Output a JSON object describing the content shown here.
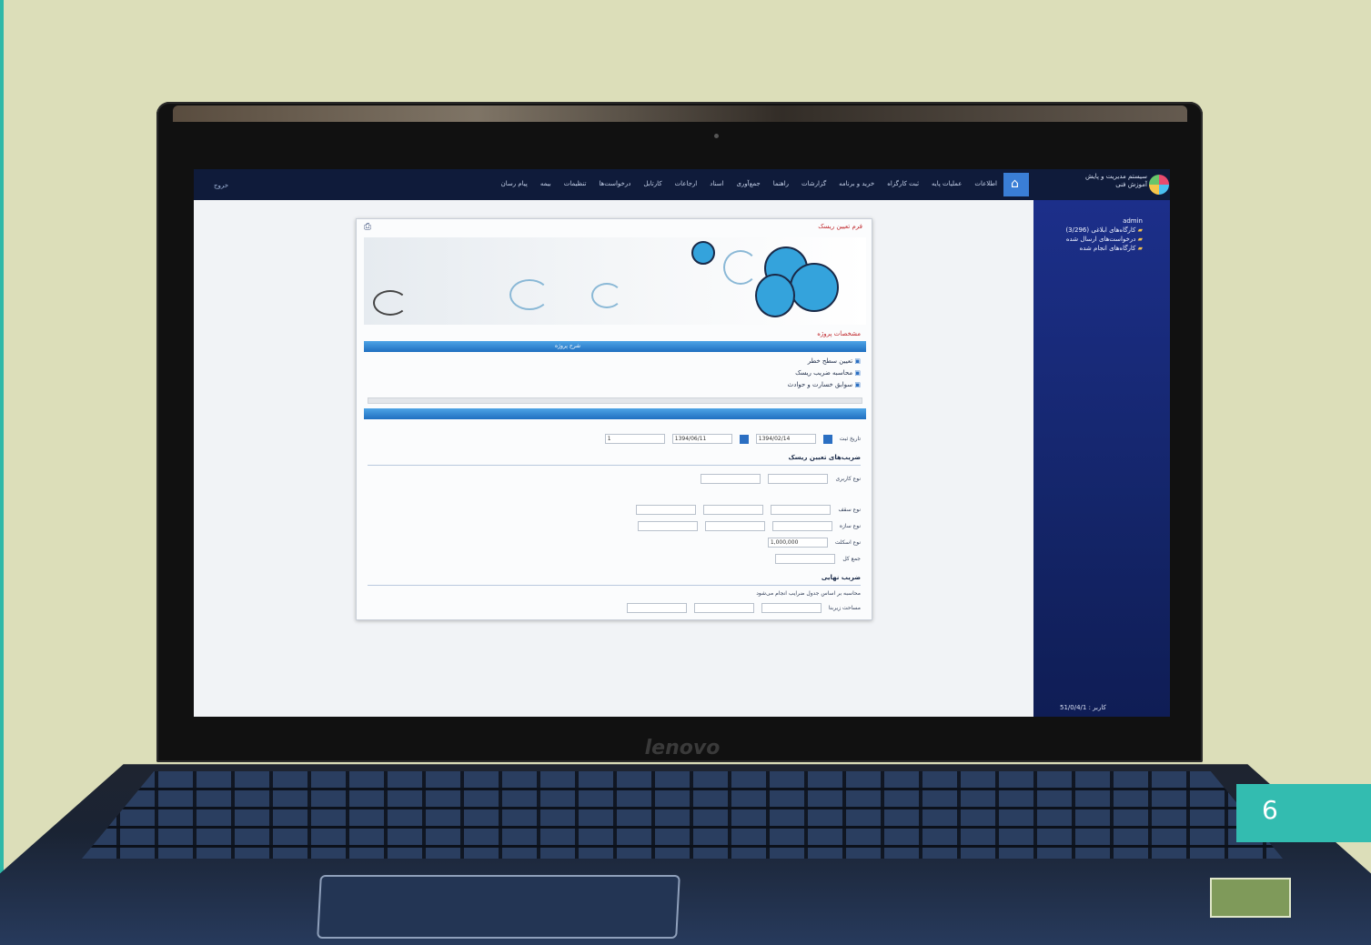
{
  "page_number": "6",
  "laptop": {
    "brand": "lenovo"
  },
  "app": {
    "logout_label": "خروج",
    "menu_items": [
      "اطلاعات",
      "عملیات پایه",
      "ثبت کارگزاه",
      "خرید و برنامه",
      "گزارشات",
      "راهنما",
      "جمع‌آوری",
      "اسناد",
      "ارجاعات",
      "کارتابل",
      "درخواست‌ها",
      "تنظیمات",
      "بیمه",
      "پیام رسان"
    ],
    "logo_text": [
      "سیستم مدیریت و پایش",
      "آموزش فنی"
    ],
    "sidebar_tree": [
      "admin",
      "کارگاه‌های ابلاغی (3/296)",
      "درخواست‌های ارسال شده",
      "کارگاه‌های انجام شده"
    ],
    "sidebar_footer": "کاربر : 51/0/4/1"
  },
  "window": {
    "title": "فرم تعیین ریسک",
    "section": "مشخصات پروژه",
    "table_header": "شرح پروژه",
    "list_items": [
      "تعیین سطح خطر",
      "محاسبه ضریب ریسک",
      "سوابق خسارت و حوادث"
    ],
    "form": {
      "date_label": "تاریخ ثبت",
      "date_value": "1394/02/14",
      "date2_value": "1394/06/11",
      "count_value": "1",
      "section_header": "ضریب‌های تعیین ریسک",
      "rows": [
        "نوع کاربری",
        "نوع سقف",
        "نوع سازه",
        "نوع اسکلت",
        "مساحت زیربنا"
      ],
      "total_value": "1,000,000",
      "total_label": "جمع کل",
      "footer_header": "ضریب نهایی",
      "footer_note": "محاسبه بر اساس جدول ضرایب انجام می‌شود"
    }
  }
}
